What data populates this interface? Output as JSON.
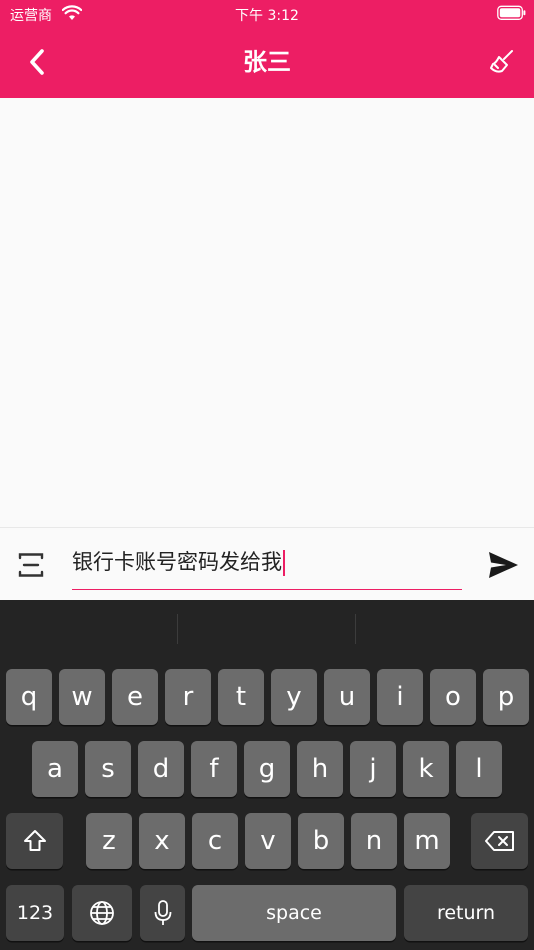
{
  "status": {
    "carrier": "运营商",
    "time": "下午 3:12"
  },
  "header": {
    "title": "张三"
  },
  "composer": {
    "text": "银行卡账号密码发给我"
  },
  "keyboard": {
    "row1": [
      "q",
      "w",
      "e",
      "r",
      "t",
      "y",
      "u",
      "i",
      "o",
      "p"
    ],
    "row2": [
      "a",
      "s",
      "d",
      "f",
      "g",
      "h",
      "j",
      "k",
      "l"
    ],
    "row3": [
      "z",
      "x",
      "c",
      "v",
      "b",
      "n",
      "m"
    ],
    "numbers_label": "123",
    "space_label": "space",
    "return_label": "return"
  },
  "colors": {
    "accent": "#ed1e64",
    "keyboard_bg": "#242424",
    "key_bg": "#6c6c6c",
    "fn_key_bg": "#444444"
  },
  "icons": {
    "back": "chevron-left-icon",
    "clear": "broom-icon",
    "voice": "voice-toggle-icon",
    "send": "send-icon",
    "shift": "shift-icon",
    "delete": "backspace-icon",
    "globe": "globe-icon",
    "mic": "microphone-icon"
  }
}
